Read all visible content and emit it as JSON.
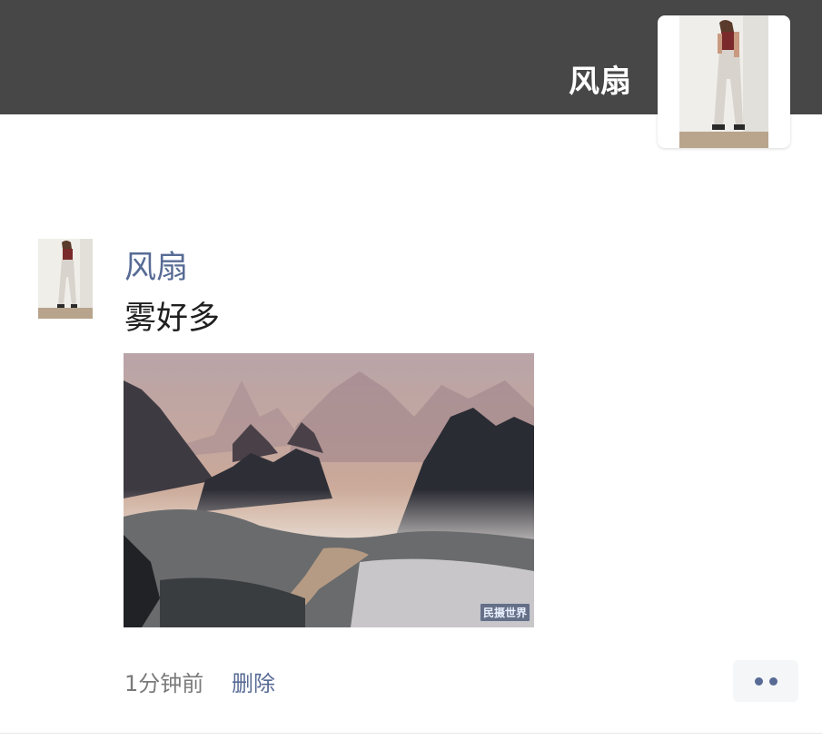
{
  "cover": {
    "username": "风扇",
    "background_color": "#474747"
  },
  "post": {
    "author_name": "风扇",
    "text": "雾好多",
    "image": {
      "watermark": "民摄世界"
    },
    "time_ago": "1分钟前",
    "delete_label": "删除",
    "more_icon": "ellipsis-icon"
  },
  "colors": {
    "link_blue": "#576b95",
    "text_dark": "#1f1f1f",
    "meta_gray": "#7a7a7a"
  }
}
